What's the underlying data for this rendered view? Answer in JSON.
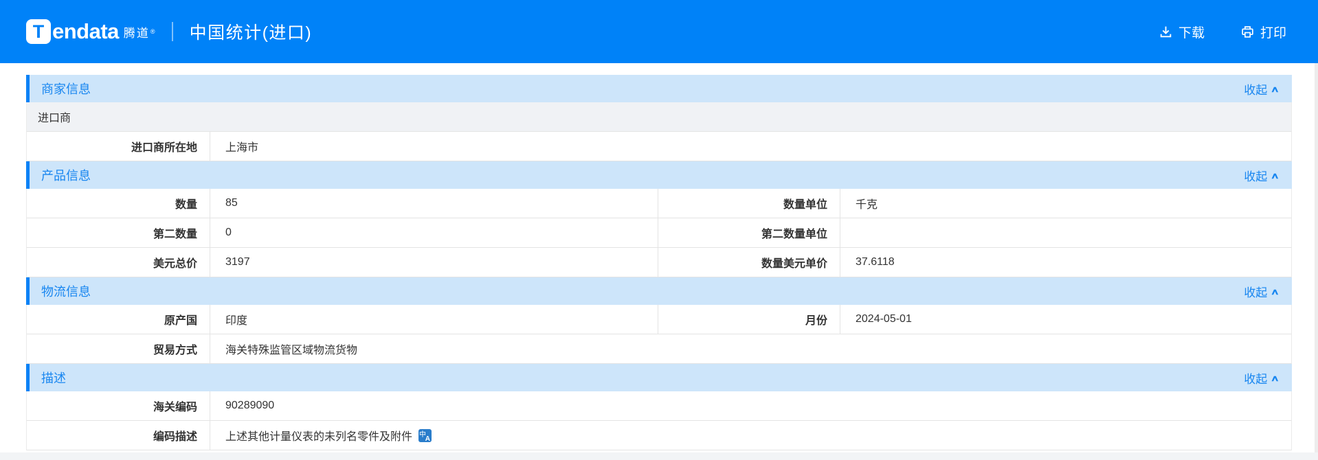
{
  "header": {
    "logo": {
      "mark_letter": "T",
      "brand": "endata",
      "brand_cn": "腾道",
      "reg_mark": "®"
    },
    "title": "中国统计(进口)",
    "actions": {
      "download": "下载",
      "print": "打印"
    }
  },
  "collapse": {
    "label": "收起",
    "chevron": "∧"
  },
  "icons": {
    "translate_zh": "中",
    "translate_a": "A"
  },
  "colors": {
    "topbar_blue": "#0082f8",
    "section_header_bg": "#cde5fa",
    "section_accent": "#0c82f6",
    "link_blue": "#1886f0",
    "row_border": "#e4e4e4",
    "full_row_bg": "#f0f2f5",
    "text": "#333333",
    "translate_icon_bg": "#2a7dcb"
  },
  "sections": [
    {
      "title": "商家信息",
      "rows": [
        {
          "type": "full",
          "text": "进口商"
        },
        {
          "type": "single",
          "label": "进口商所在地",
          "value": "上海市"
        }
      ]
    },
    {
      "title": "产品信息",
      "rows": [
        {
          "type": "double",
          "label1": "数量",
          "value1": "85",
          "label2": "数量单位",
          "value2": "千克"
        },
        {
          "type": "double",
          "label1": "第二数量",
          "value1": "0",
          "label2": "第二数量单位",
          "value2": ""
        },
        {
          "type": "double",
          "label1": "美元总价",
          "value1": "3197",
          "label2": "数量美元单价",
          "value2": "37.6118"
        }
      ]
    },
    {
      "title": "物流信息",
      "rows": [
        {
          "type": "double",
          "label1": "原产国",
          "value1": "印度",
          "label2": "月份",
          "value2": "2024-05-01"
        },
        {
          "type": "single",
          "label": "贸易方式",
          "value": "海关特殊监管区域物流货物"
        }
      ]
    },
    {
      "title": "描述",
      "rows": [
        {
          "type": "single",
          "label": "海关编码",
          "value": "90289090"
        },
        {
          "type": "single",
          "label": "编码描述",
          "value": "上述其他计量仪表的未列名零件及附件",
          "icon": "translate-icon"
        }
      ]
    }
  ]
}
